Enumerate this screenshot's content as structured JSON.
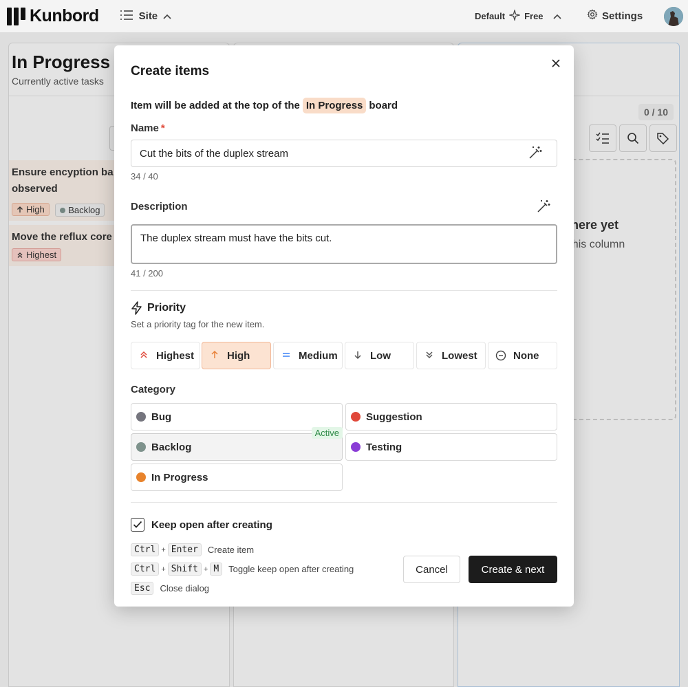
{
  "app": {
    "logo_text": "Kunbord",
    "site_label": "Site",
    "plan_default": "Default",
    "plan_tier": "Free",
    "settings_label": "Settings"
  },
  "board": {
    "column1": {
      "title": "In Progress",
      "subtitle": "Currently active tasks",
      "tasks": [
        {
          "title": "Ensure encyption ba",
          "title_cont": "observed",
          "priority": "High",
          "category": "Backlog"
        },
        {
          "title": "Move the reflux core",
          "priority": "Highest"
        }
      ]
    },
    "column3": {
      "count": "0 / 10",
      "empty_title": "here yet",
      "empty_sub": "o this column"
    }
  },
  "modal": {
    "title": "Create items",
    "board_line_prefix": "Item will be added at the top of the",
    "board_name": "In Progress",
    "board_line_suffix": "board",
    "name_label": "Name",
    "required_mark": "*",
    "name_value": "Cut the bits of the duplex stream",
    "name_counter": "34 / 40",
    "description_label": "Description",
    "description_value": "The duplex stream must have the bits cut.",
    "description_counter": "41 / 200",
    "priority_title": "Priority",
    "priority_sub": "Set a priority tag for the new item.",
    "priorities": [
      {
        "label": "Highest",
        "icon": "chevrons-up-icon",
        "color": "#e0483a"
      },
      {
        "label": "High",
        "icon": "arrow-up-icon",
        "color": "#e8823a",
        "active": true
      },
      {
        "label": "Medium",
        "icon": "equals-icon",
        "color": "#3b82f6"
      },
      {
        "label": "Low",
        "icon": "arrow-down-icon",
        "color": "#555555"
      },
      {
        "label": "Lowest",
        "icon": "chevrons-down-icon",
        "color": "#555555"
      },
      {
        "label": "None",
        "icon": "circle-minus-icon",
        "color": "#444444"
      }
    ],
    "category_label": "Category",
    "categories": [
      {
        "label": "Bug",
        "color": "#75757e"
      },
      {
        "label": "Suggestion",
        "color": "#e0483a"
      },
      {
        "label": "Backlog",
        "color": "#7e928c",
        "active": true
      },
      {
        "label": "Testing",
        "color": "#8a3dd6"
      },
      {
        "label": "In Progress",
        "color": "#e8832c"
      }
    ],
    "active_badge": "Active",
    "keep_open_label": "Keep open after creating",
    "keep_open_checked": true,
    "shortcuts": [
      {
        "keys": [
          "Ctrl",
          "Enter"
        ],
        "desc": "Create item"
      },
      {
        "keys": [
          "Ctrl",
          "Shift",
          "M"
        ],
        "desc": "Toggle keep open after creating"
      },
      {
        "keys": [
          "Esc"
        ],
        "desc": "Close dialog"
      }
    ],
    "cancel_label": "Cancel",
    "create_label": "Create & next"
  }
}
